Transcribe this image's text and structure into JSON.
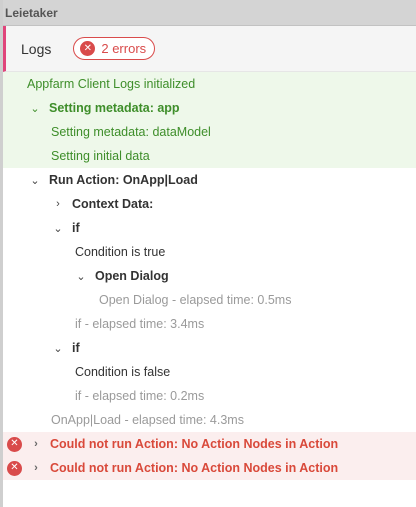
{
  "window": {
    "title": "Leietaker"
  },
  "panel": {
    "title": "Logs",
    "error_badge": "2 errors"
  },
  "logs": {
    "init": "Appfarm Client Logs initialized",
    "setting_metadata_app": "Setting metadata: app",
    "setting_metadata_datamodel": "Setting metadata: dataModel",
    "setting_initial_data": "Setting initial data",
    "run_action": "Run Action: OnApp|Load",
    "context_data": "Context Data:",
    "if_1": "if",
    "condition_true": "Condition is true",
    "open_dialog": "Open Dialog",
    "open_dialog_elapsed": "Open Dialog - elapsed time: 0.5ms",
    "if_1_elapsed": "if - elapsed time: 3.4ms",
    "if_2": "if",
    "condition_false": "Condition is false",
    "if_2_elapsed": "if - elapsed time: 0.2ms",
    "onapp_elapsed": "OnApp|Load - elapsed time: 4.3ms",
    "error_1": "Could not run Action: No Action Nodes in Action",
    "error_2": "Could not run Action: No Action Nodes in Action"
  },
  "icons": {
    "error": "error-circle-icon",
    "expanded": "chevron-down-icon",
    "collapsed": "chevron-right-icon"
  },
  "colors": {
    "accent": "#e0457b",
    "error": "#d94b4b",
    "success_text": "#3e8e2a",
    "success_bg": "#eef8ea",
    "error_bg": "#fbeeee"
  }
}
